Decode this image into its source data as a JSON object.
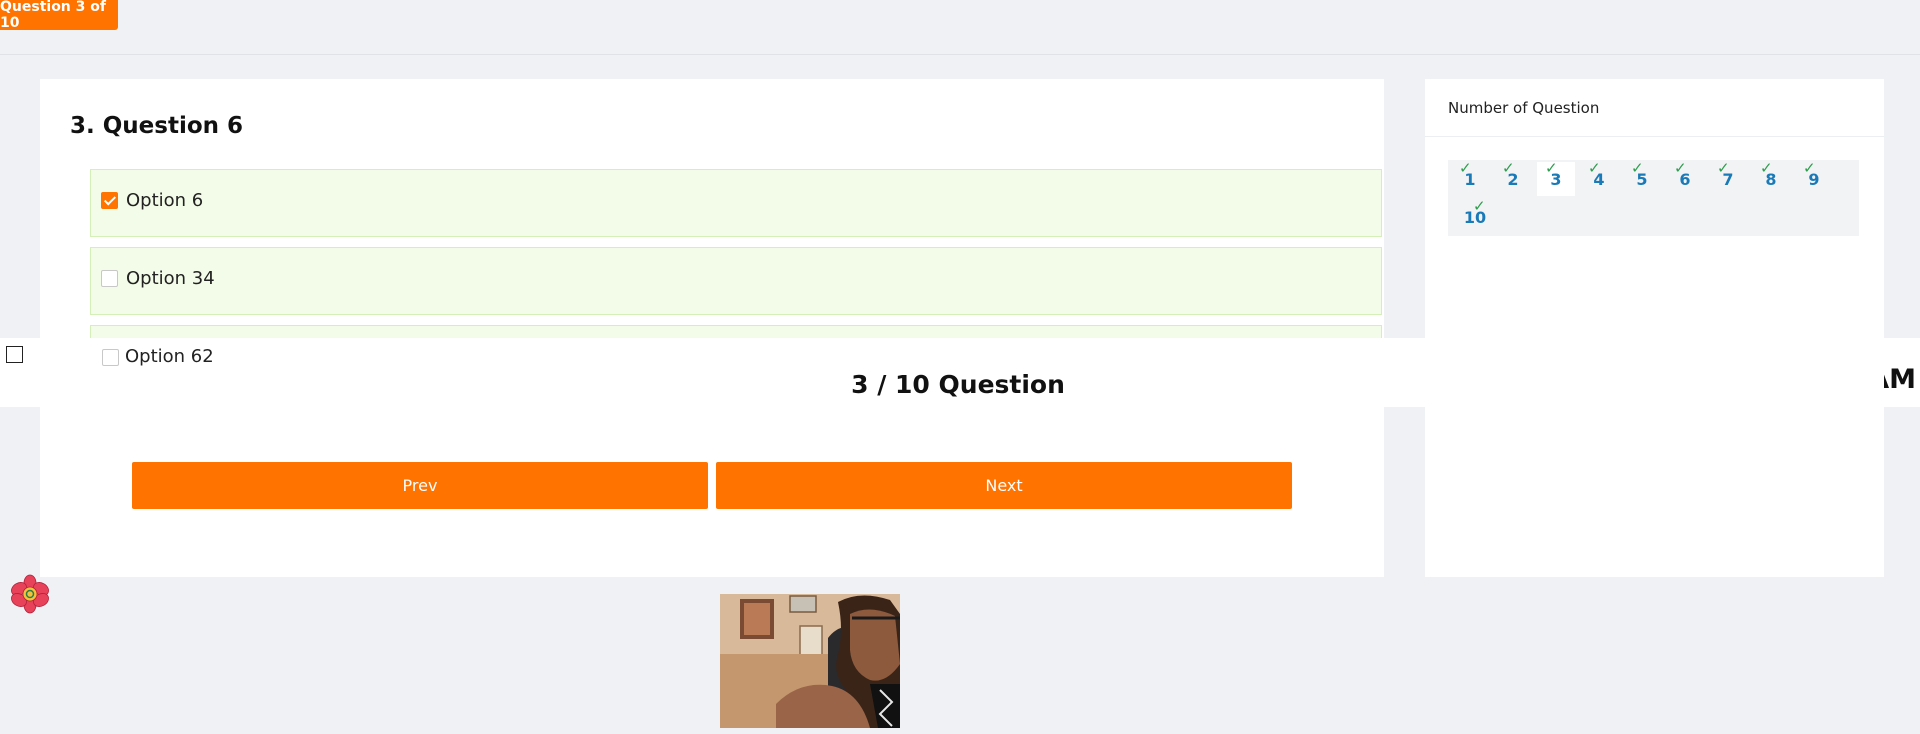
{
  "header": {
    "badge": "Question 3 of 10"
  },
  "question": {
    "title": "3. Question 6",
    "options": [
      {
        "label": "Option 6",
        "checked": true
      },
      {
        "label": "Option 34",
        "checked": false
      },
      {
        "label": "Option 62",
        "checked": false
      }
    ]
  },
  "overlay": {
    "counter": "3 / 10 Question",
    "clock_fragment": "AM"
  },
  "buttons": {
    "prev": "Prev",
    "next": "Next"
  },
  "sidebar": {
    "title": "Number of Question",
    "questions": [
      {
        "number": "1",
        "answered": true
      },
      {
        "number": "2",
        "answered": true
      },
      {
        "number": "3",
        "answered": true,
        "current": true
      },
      {
        "number": "4",
        "answered": true
      },
      {
        "number": "5",
        "answered": true
      },
      {
        "number": "6",
        "answered": true
      },
      {
        "number": "7",
        "answered": true
      },
      {
        "number": "8",
        "answered": true
      },
      {
        "number": "9",
        "answered": true
      },
      {
        "number": "10",
        "answered": true
      }
    ],
    "tick_glyph": "✓"
  },
  "colors": {
    "accent": "#ff7300",
    "option_bg": "#f3fce8",
    "nav_number": "#1a7ab8",
    "tick": "#2e9e4e"
  },
  "icons": {
    "floating": "flower-icon",
    "webcam": "webcam-preview"
  }
}
